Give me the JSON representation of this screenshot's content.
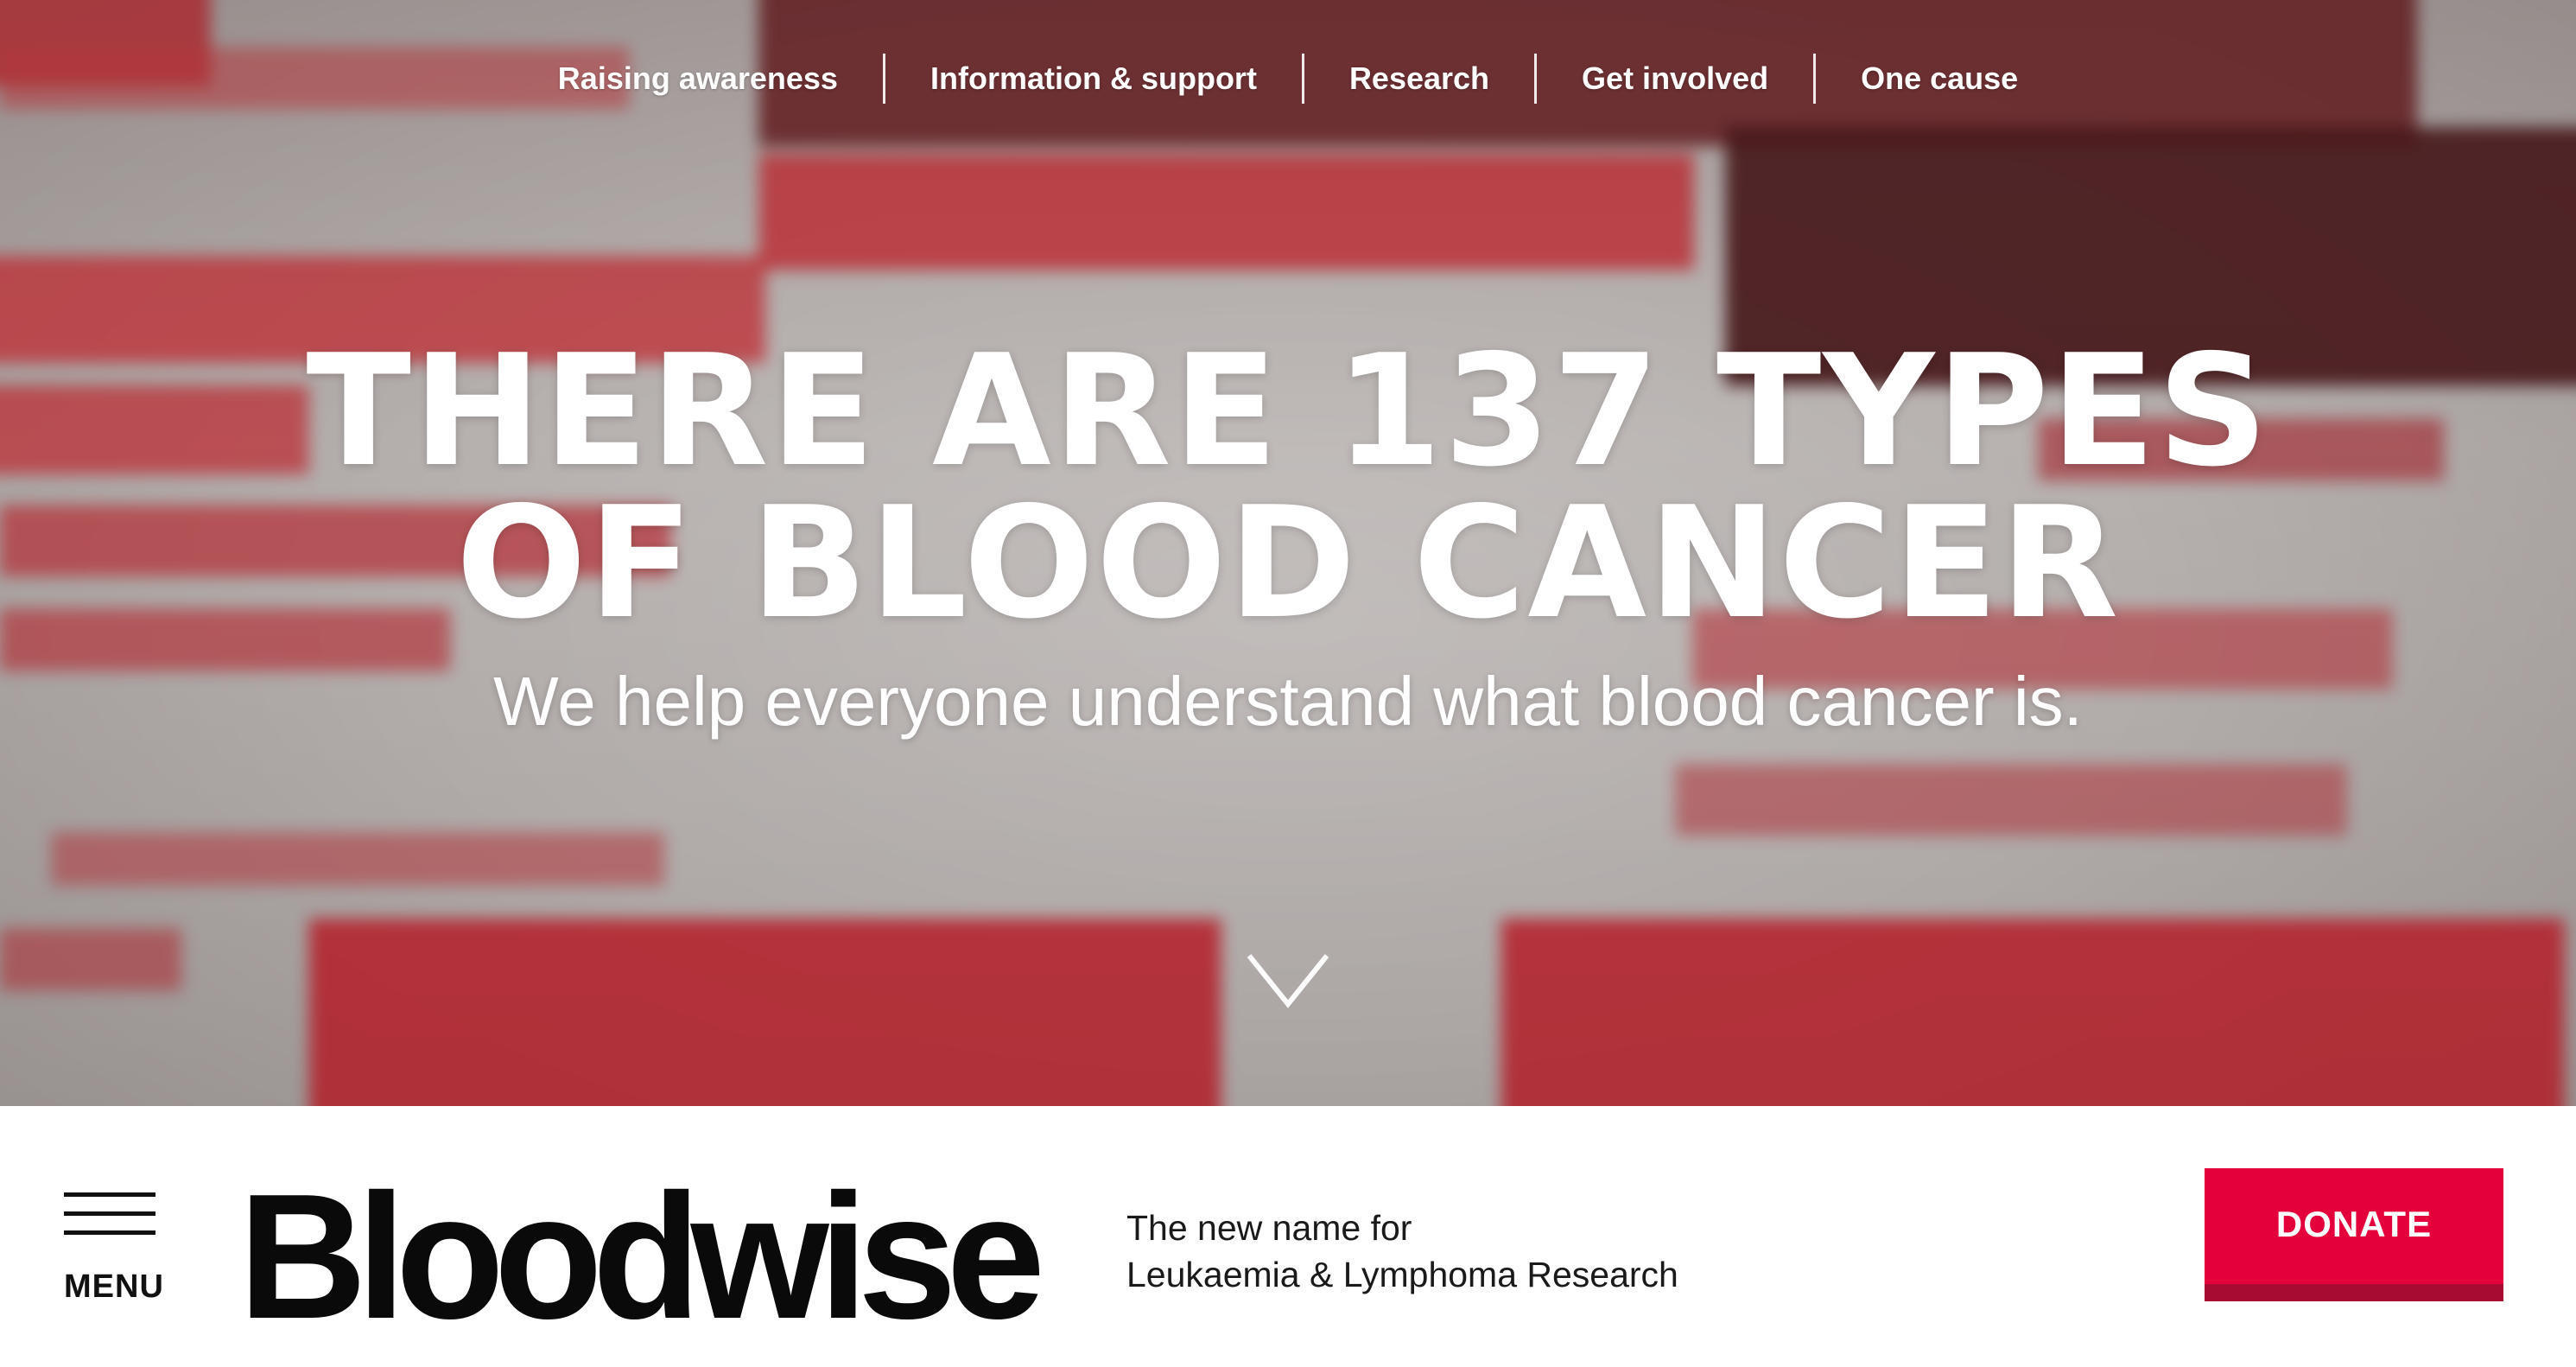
{
  "nav": {
    "items": [
      {
        "label": "Raising awareness"
      },
      {
        "label": "Information & support"
      },
      {
        "label": "Research"
      },
      {
        "label": "Get involved"
      },
      {
        "label": "One cause"
      }
    ]
  },
  "hero": {
    "headline_line1": "THERE ARE 137 TYPES",
    "headline_line2": "OF BLOOD CANCER",
    "subheadline": "We help everyone understand what blood cancer is.",
    "scroll_icon": "chevron-down-icon"
  },
  "footer_bar": {
    "menu_icon": "hamburger-icon",
    "menu_label": "MENU",
    "logo_text": "Bloodwise",
    "tagline_line1": "The new name for",
    "tagline_line2": "Leukaemia & Lymphoma Research",
    "donate_label": "DONATE"
  },
  "colors": {
    "accent_red": "#e4003a",
    "accent_red_dark": "#a80b31",
    "background_text_red": "#d21f2b",
    "background_text_dark": "#5a1418"
  }
}
